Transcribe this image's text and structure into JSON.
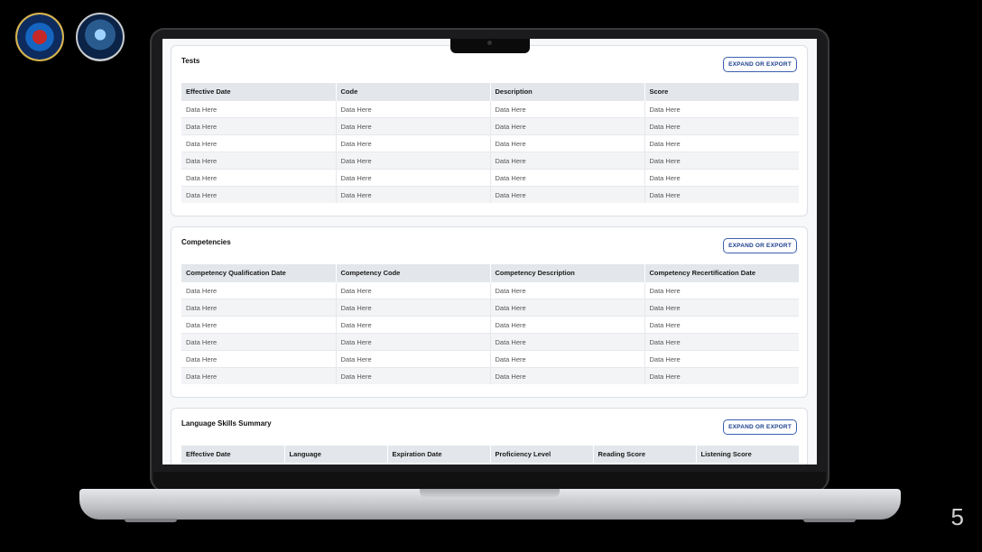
{
  "slide": {
    "page_number": "5"
  },
  "tests": {
    "title": "Tests",
    "export_label": "EXPAND OR EXPORT",
    "columns": [
      "Effective Date",
      "Code",
      "Description",
      "Score"
    ],
    "rows": [
      [
        "Data Here",
        "Data Here",
        "Data Here",
        "Data Here"
      ],
      [
        "Data Here",
        "Data Here",
        "Data Here",
        "Data Here"
      ],
      [
        "Data Here",
        "Data Here",
        "Data Here",
        "Data Here"
      ],
      [
        "Data Here",
        "Data Here",
        "Data Here",
        "Data Here"
      ],
      [
        "Data Here",
        "Data Here",
        "Data Here",
        "Data Here"
      ],
      [
        "Data Here",
        "Data Here",
        "Data Here",
        "Data Here"
      ]
    ]
  },
  "competencies": {
    "title": "Competencies",
    "export_label": "EXPAND OR EXPORT",
    "columns": [
      "Competency Qualification Date",
      "Competency Code",
      "Competency Description",
      "Competency Recertification Date"
    ],
    "rows": [
      [
        "Data Here",
        "Data Here",
        "Data Here",
        "Data Here"
      ],
      [
        "Data Here",
        "Data Here",
        "Data Here",
        "Data Here"
      ],
      [
        "Data Here",
        "Data Here",
        "Data Here",
        "Data Here"
      ],
      [
        "Data Here",
        "Data Here",
        "Data Here",
        "Data Here"
      ],
      [
        "Data Here",
        "Data Here",
        "Data Here",
        "Data Here"
      ],
      [
        "Data Here",
        "Data Here",
        "Data Here",
        "Data Here"
      ]
    ]
  },
  "language_skills": {
    "title": "Language Skills Summary",
    "export_label": "EXPAND OR EXPORT",
    "columns": [
      "Effective Date",
      "Language",
      "Expiration Date",
      "Proficiency Level",
      "Reading Score",
      "Listening Score"
    ],
    "rows": []
  }
}
